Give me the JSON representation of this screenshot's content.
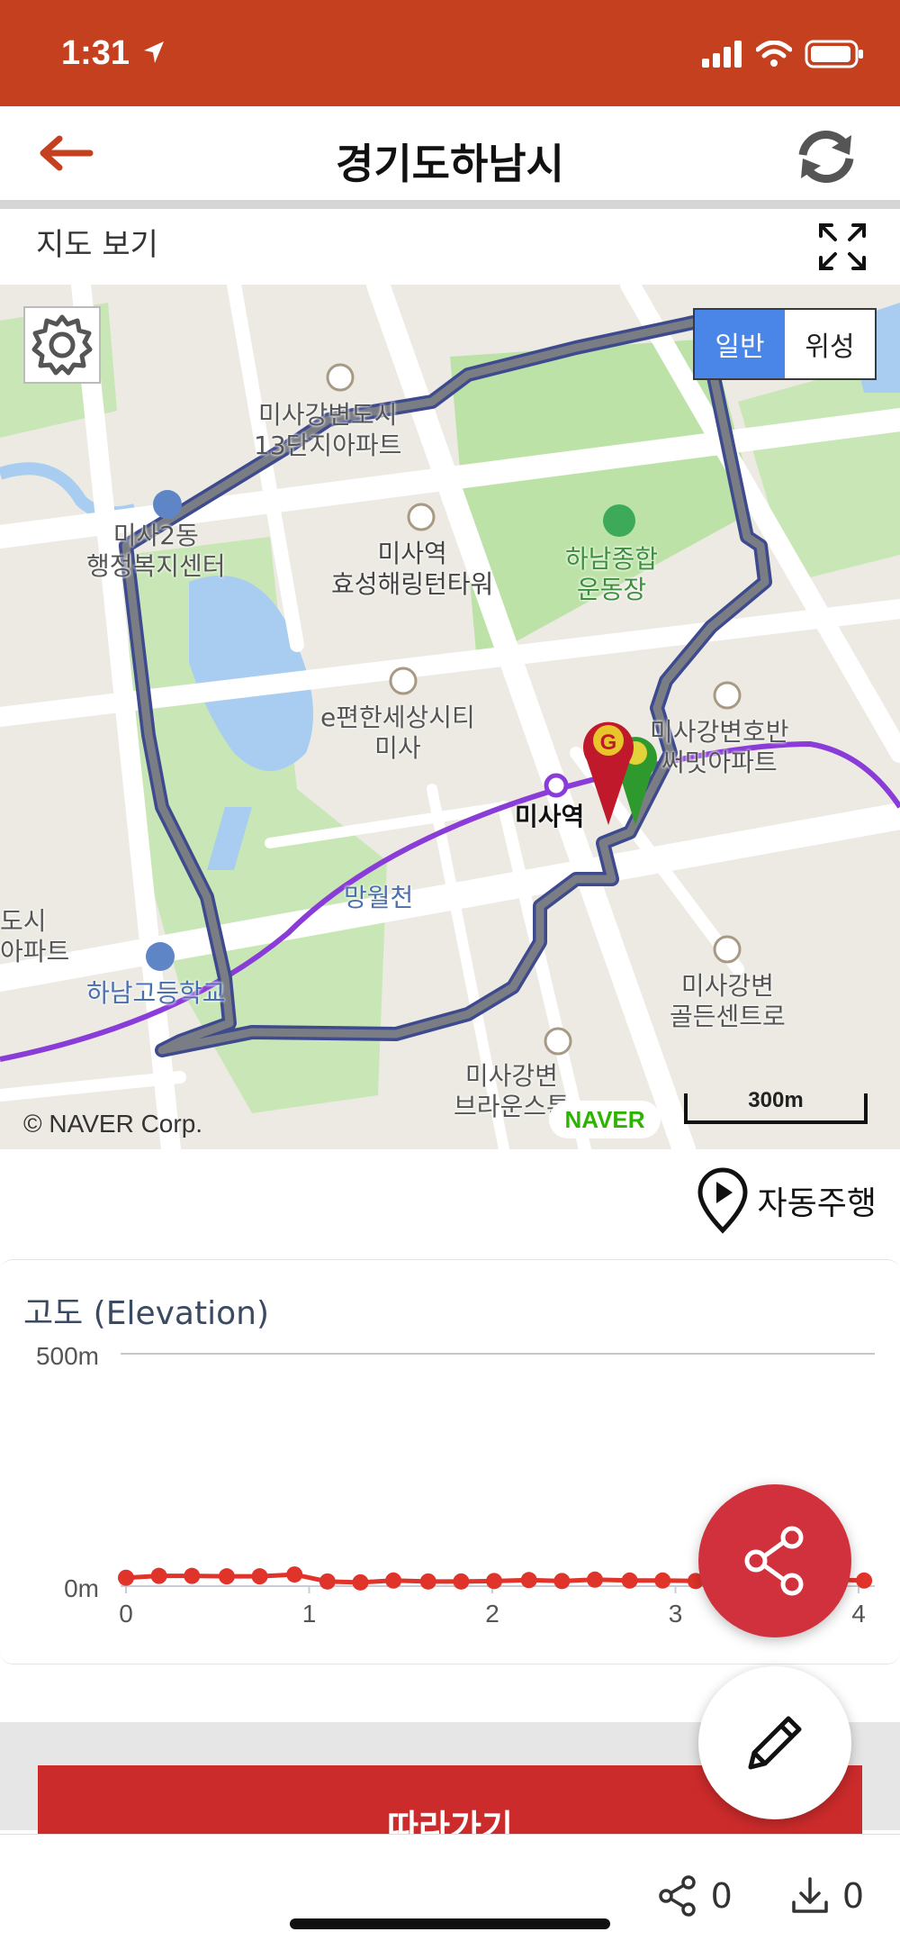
{
  "status_bar": {
    "time": "1:31"
  },
  "header": {
    "title": "경기도하남시"
  },
  "map_section": {
    "label": "지도 보기"
  },
  "map": {
    "type_toggle": {
      "normal": "일반",
      "satellite": "위성",
      "selected": "일반"
    },
    "copyright": "© NAVER Corp.",
    "logo": "NAVER",
    "scale": "300m",
    "labels": {
      "misa13": "미사강변도시\n13단지아파트",
      "misa2dong": "미사2동\n행정복지센터",
      "hyosung": "미사역\n효성해링턴타워",
      "stadium": "하남종합\n운동장",
      "epyeonhan": "e편한세상시티\n미사",
      "station": "미사역",
      "hoban": "미사강변호반\n써밋아파트",
      "mangwol": "망월천",
      "hanamgo": "하남고등학교",
      "goldencentro": "미사강변\n골든센트로",
      "brownstone": "미사강변\n브라운스톤",
      "dosi": "도시\n아파트"
    }
  },
  "auto_drive": {
    "label": "자동주행"
  },
  "elevation": {
    "title": "고도 (Elevation)"
  },
  "chart_data": {
    "type": "line",
    "ylim": [
      0,
      500
    ],
    "y_ticks": [
      "500m",
      "0m"
    ],
    "xlim": [
      0,
      4
    ],
    "x_ticks": [
      "0",
      "1",
      "2",
      "3",
      "4"
    ],
    "x": [
      0,
      0.18,
      0.36,
      0.55,
      0.73,
      0.92,
      1.1,
      1.28,
      1.46,
      1.65,
      1.83,
      2.01,
      2.2,
      2.38,
      2.56,
      2.75,
      2.93,
      3.11,
      3.3,
      3.48,
      3.66,
      3.85,
      4.03
    ],
    "values": [
      18,
      22,
      22,
      21,
      21,
      25,
      10,
      8,
      12,
      10,
      10,
      11,
      13,
      11,
      14,
      12,
      12,
      11,
      10,
      10,
      12,
      14,
      12
    ],
    "grid": true
  },
  "actions": {
    "follow": "따라가기"
  },
  "footer": {
    "share_count": "0",
    "download_count": "0"
  },
  "colors": {
    "brand": "#c5401f",
    "accent": "#cc2b2b",
    "route": "#3e4a8e",
    "subway": "#8a3cd8"
  }
}
